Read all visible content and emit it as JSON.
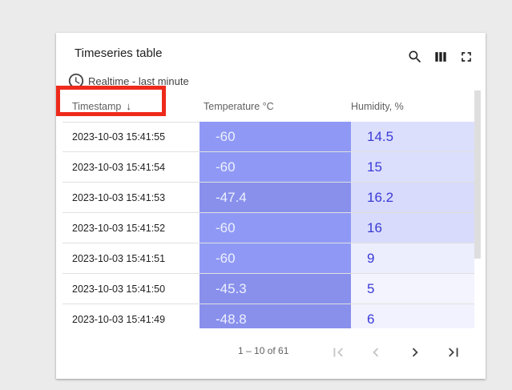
{
  "widget": {
    "title": "Timeseries table",
    "realtime_label": "Realtime - last minute",
    "icons": {
      "search": "search-icon",
      "columns": "columns-icon",
      "fullscreen": "fullscreen-icon",
      "clock": "clock-icon"
    }
  },
  "table": {
    "columns": {
      "timestamp": "Timestamp",
      "temperature": "Temperature °C",
      "humidity": "Humidity, %"
    },
    "sort_arrow": "↓",
    "rows": [
      {
        "ts": "2023-10-03 15:41:55",
        "temp": "-60",
        "hum": "14.5",
        "temp_bg": "#8f99f5",
        "hum_bg": "#dcdffc"
      },
      {
        "ts": "2023-10-03 15:41:54",
        "temp": "-60",
        "hum": "15",
        "temp_bg": "#8f99f5",
        "hum_bg": "#dcdffc"
      },
      {
        "ts": "2023-10-03 15:41:53",
        "temp": "-47.4",
        "hum": "16.2",
        "temp_bg": "#8890ec",
        "hum_bg": "#d8dbfb"
      },
      {
        "ts": "2023-10-03 15:41:52",
        "temp": "-60",
        "hum": "16",
        "temp_bg": "#8f99f5",
        "hum_bg": "#d8dbfb"
      },
      {
        "ts": "2023-10-03 15:41:51",
        "temp": "-60",
        "hum": "9",
        "temp_bg": "#8f99f5",
        "hum_bg": "#eceefd"
      },
      {
        "ts": "2023-10-03 15:41:50",
        "temp": "-45.3",
        "hum": "5",
        "temp_bg": "#8890ec",
        "hum_bg": "#f3f4fe"
      },
      {
        "ts": "2023-10-03 15:41:49",
        "temp": "-48.8",
        "hum": "6",
        "temp_bg": "#8890ec",
        "hum_bg": "#f1f2fe"
      }
    ]
  },
  "pagination": {
    "range_label": "1 – 10 of 61",
    "icons": {
      "first": "first-page-icon",
      "prev": "prev-page-icon",
      "next": "next-page-icon",
      "last": "last-page-icon"
    }
  },
  "colors": {
    "highlight": "#ee2a1b",
    "humidity_text": "#3a3ad6",
    "temp_text": "#eef0ff"
  }
}
